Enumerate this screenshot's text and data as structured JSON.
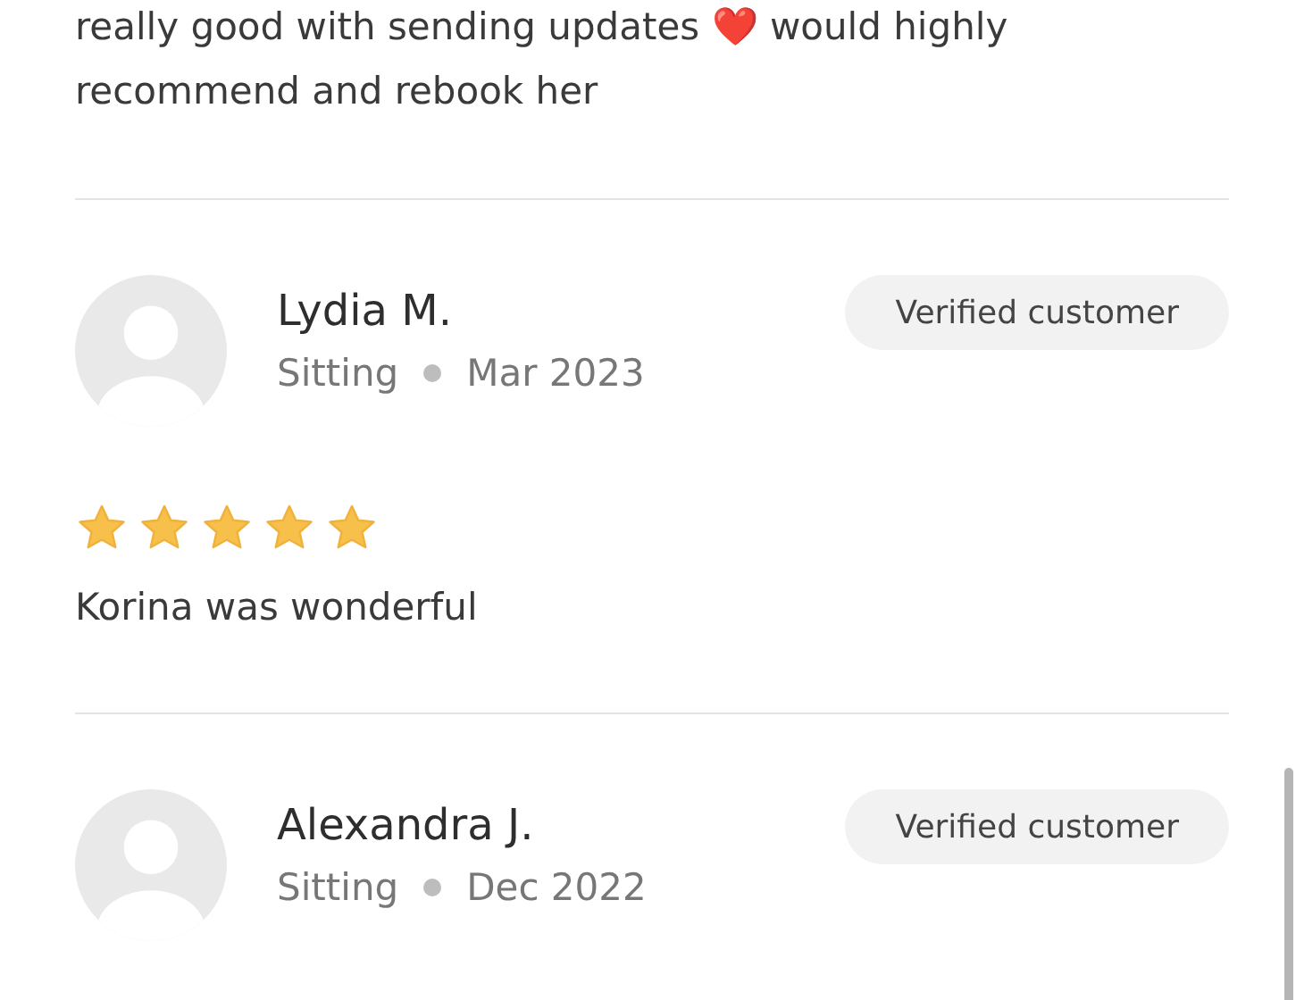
{
  "previous_review": {
    "text_segments": [
      {
        "kind": "text",
        "text": "really good with sending updates "
      },
      {
        "kind": "emoji",
        "text": "❤️"
      },
      {
        "kind": "text",
        "text": " would highly recommend and rebook her"
      }
    ]
  },
  "reviews": [
    {
      "name": "Lydia M.",
      "service": "Sitting",
      "date": "Mar 2023",
      "badge": "Verified customer",
      "stars": 5,
      "text": "Korina was wonderful"
    },
    {
      "name": "Alexandra J.",
      "service": "Sitting",
      "date": "Dec 2022",
      "badge": "Verified customer"
    }
  ]
}
